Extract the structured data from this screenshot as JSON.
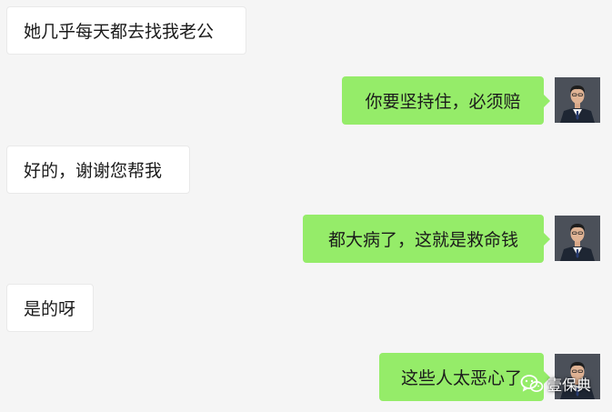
{
  "messages": [
    {
      "side": "left",
      "text": "她几乎每天都去找我老公"
    },
    {
      "side": "right",
      "text": "你要坚持住，必须赔"
    },
    {
      "side": "left",
      "text": "好的，谢谢您帮我"
    },
    {
      "side": "right",
      "text": "都大病了，这就是救命钱"
    },
    {
      "side": "left",
      "text": "是的呀"
    },
    {
      "side": "right",
      "text": "这些人太恶心了"
    }
  ],
  "watermark": {
    "icon": "wechat-icon",
    "text": "壹保典"
  },
  "colors": {
    "background": "#f5f5f5",
    "incoming_bubble": "#ffffff",
    "outgoing_bubble": "#95ec69",
    "text": "#1b1b1b"
  }
}
